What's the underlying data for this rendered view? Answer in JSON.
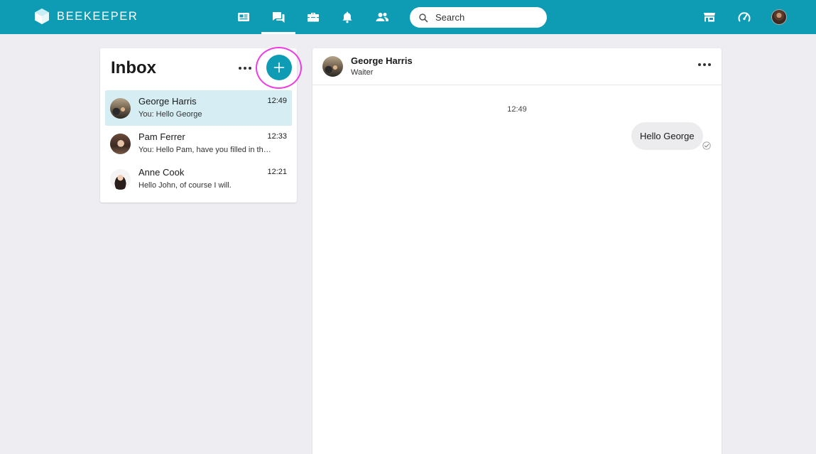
{
  "app": {
    "brand": "BEEKEEPER"
  },
  "nav": {
    "items": [
      {
        "name": "news-icon",
        "active": false
      },
      {
        "name": "chat-icon",
        "active": true
      },
      {
        "name": "toolbox-icon",
        "active": false
      },
      {
        "name": "bell-icon",
        "active": false
      },
      {
        "name": "people-icon",
        "active": false
      }
    ],
    "right": [
      {
        "name": "marketplace-icon"
      },
      {
        "name": "dashboard-icon"
      }
    ]
  },
  "search": {
    "placeholder": "Search"
  },
  "colors": {
    "brand": "#0e9bb4",
    "highlight": "#ee3ce0",
    "selected_row": "#d6eef3",
    "background": "#eeedf2"
  },
  "inbox": {
    "title": "Inbox",
    "conversations": [
      {
        "name": "George Harris",
        "time": "12:49",
        "preview": "You: Hello George",
        "selected": true
      },
      {
        "name": "Pam Ferrer",
        "time": "12:33",
        "preview": "You: Hello Pam, have you filled in th…",
        "selected": false
      },
      {
        "name": "Anne Cook",
        "time": "12:21",
        "preview": "Hello John, of course I will.",
        "selected": false
      }
    ]
  },
  "chat": {
    "name": "George Harris",
    "role": "Waiter",
    "messages": [
      {
        "time": "12:49",
        "text": "Hello George",
        "outgoing": true
      }
    ]
  }
}
